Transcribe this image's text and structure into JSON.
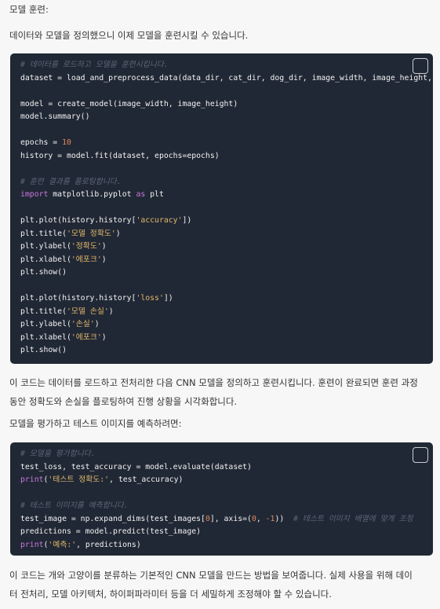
{
  "sections": {
    "heading": "모델 훈련:",
    "intro": "데이터와 모델을 정의했으니 이제 모델을 훈련시킬 수 있습니다.",
    "desc1": "이 코드는 데이터를 로드하고 전처리한 다음 CNN 모델을 정의하고 훈련시킵니다. 훈련이 완료되면 훈련 과정\n동안 정확도와 손실을 플로팅하여 진행 상황을 시각화합니다.",
    "eval_intro": "모델을 평가하고 테스트 이미지를 예측하려면:",
    "desc2": "이 코드는 개와 고양이를 분류하는 기본적인 CNN 모델을 만드는 방법을 보여줍니다. 실제 사용을 위해 데이\n터 전처리, 모델 아키텍처, 하이퍼파라미터 등을 더 세밀하게 조정해야 할 수 있습니다."
  },
  "code_blocks": [
    {
      "copy_icon": "copy-icon",
      "lines": [
        [
          {
            "t": "comment",
            "v": "# 데이터를 로드하고 모델을 훈련시킵니다."
          }
        ],
        [
          {
            "t": "plain",
            "v": "dataset = load_and_preprocess_data(data_dir, cat_dir, dog_dir, image_width, image_height, batch_size)"
          }
        ],
        [],
        [
          {
            "t": "plain",
            "v": "model = create_model(image_width, image_height)"
          }
        ],
        [
          {
            "t": "plain",
            "v": "model.summary()"
          }
        ],
        [],
        [
          {
            "t": "plain",
            "v": "epochs = "
          },
          {
            "t": "number",
            "v": "10"
          }
        ],
        [
          {
            "t": "plain",
            "v": "history = model.fit(dataset, epochs=epochs)"
          }
        ],
        [],
        [
          {
            "t": "comment",
            "v": "# 훈련 결과를 플로팅합니다."
          }
        ],
        [
          {
            "t": "keyword",
            "v": "import"
          },
          {
            "t": "plain",
            "v": " matplotlib.pyplot "
          },
          {
            "t": "keyword",
            "v": "as"
          },
          {
            "t": "plain",
            "v": " plt"
          }
        ],
        [],
        [
          {
            "t": "plain",
            "v": "plt.plot(history.history["
          },
          {
            "t": "string",
            "v": "'accuracy'"
          },
          {
            "t": "plain",
            "v": "])"
          }
        ],
        [
          {
            "t": "plain",
            "v": "plt.title("
          },
          {
            "t": "string",
            "v": "'모델 정확도'"
          },
          {
            "t": "plain",
            "v": ")"
          }
        ],
        [
          {
            "t": "plain",
            "v": "plt.ylabel("
          },
          {
            "t": "string",
            "v": "'정확도'"
          },
          {
            "t": "plain",
            "v": ")"
          }
        ],
        [
          {
            "t": "plain",
            "v": "plt.xlabel("
          },
          {
            "t": "string",
            "v": "'에포크'"
          },
          {
            "t": "plain",
            "v": ")"
          }
        ],
        [
          {
            "t": "plain",
            "v": "plt.show()"
          }
        ],
        [],
        [
          {
            "t": "plain",
            "v": "plt.plot(history.history["
          },
          {
            "t": "string",
            "v": "'loss'"
          },
          {
            "t": "plain",
            "v": "])"
          }
        ],
        [
          {
            "t": "plain",
            "v": "plt.title("
          },
          {
            "t": "string",
            "v": "'모델 손실'"
          },
          {
            "t": "plain",
            "v": ")"
          }
        ],
        [
          {
            "t": "plain",
            "v": "plt.ylabel("
          },
          {
            "t": "string",
            "v": "'손실'"
          },
          {
            "t": "plain",
            "v": ")"
          }
        ],
        [
          {
            "t": "plain",
            "v": "plt.xlabel("
          },
          {
            "t": "string",
            "v": "'에포크'"
          },
          {
            "t": "plain",
            "v": ")"
          }
        ],
        [
          {
            "t": "plain",
            "v": "plt.show()"
          }
        ]
      ]
    },
    {
      "copy_icon": "copy-icon",
      "lines": [
        [
          {
            "t": "comment",
            "v": "# 모델을 평가합니다."
          }
        ],
        [
          {
            "t": "plain",
            "v": "test_loss, test_accuracy = model.evaluate(dataset)"
          }
        ],
        [
          {
            "t": "keyword",
            "v": "print"
          },
          {
            "t": "plain",
            "v": "("
          },
          {
            "t": "string",
            "v": "'테스트 정확도:'"
          },
          {
            "t": "plain",
            "v": ", test_accuracy)"
          }
        ],
        [],
        [
          {
            "t": "comment",
            "v": "# 테스트 이미지를 예측합니다."
          }
        ],
        [
          {
            "t": "plain",
            "v": "test_image = np.expand_dims(test_images["
          },
          {
            "t": "number",
            "v": "0"
          },
          {
            "t": "plain",
            "v": "], axis=("
          },
          {
            "t": "number",
            "v": "0"
          },
          {
            "t": "plain",
            "v": ", "
          },
          {
            "t": "number",
            "v": "-1"
          },
          {
            "t": "plain",
            "v": "))  "
          },
          {
            "t": "comment",
            "v": "# 테스트 이미지 배열에 맞게 조정"
          }
        ],
        [
          {
            "t": "plain",
            "v": "predictions = model.predict(test_image)"
          }
        ],
        [
          {
            "t": "keyword",
            "v": "print"
          },
          {
            "t": "plain",
            "v": "("
          },
          {
            "t": "string",
            "v": "'예측:'"
          },
          {
            "t": "plain",
            "v": ", predictions)"
          }
        ]
      ]
    }
  ]
}
